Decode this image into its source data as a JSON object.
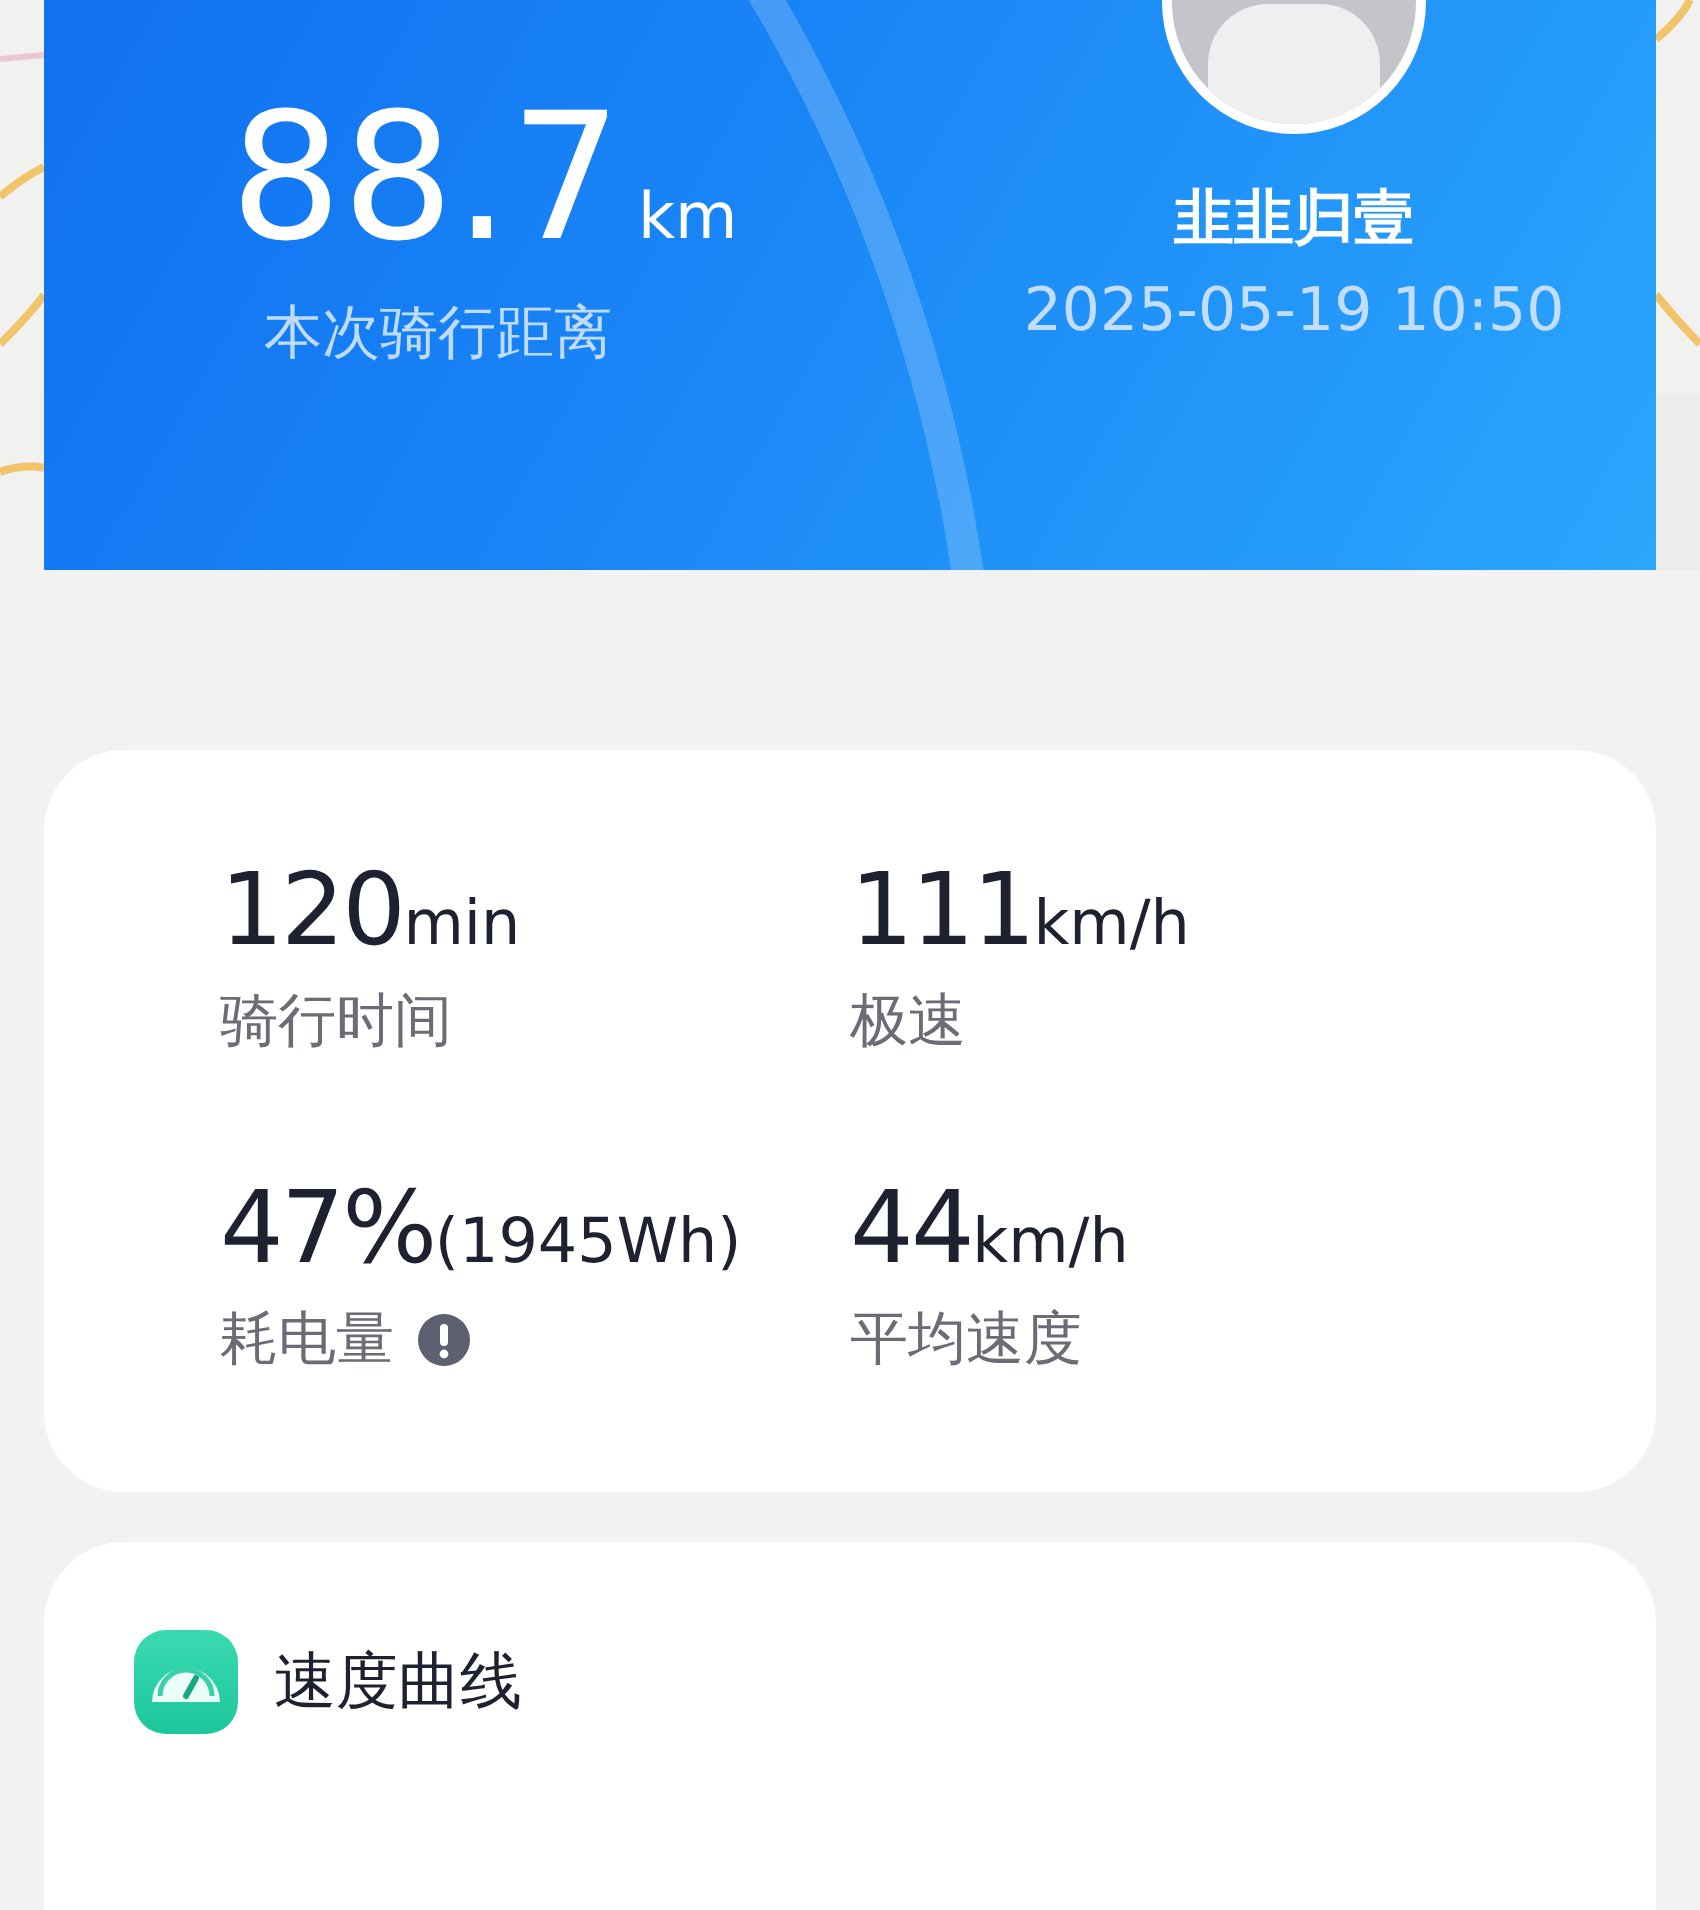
{
  "ride": {
    "distance": "88.7",
    "distance_unit": "km",
    "distance_label": "本次骑行距离",
    "rider_name": "韭韭归壹",
    "datetime": "2025-05-19 10:50"
  },
  "stats": [
    {
      "value": "120",
      "unit": "min",
      "label": "骑行时间",
      "info": false
    },
    {
      "value": "111",
      "unit": "km/h",
      "label": "极速",
      "info": false
    },
    {
      "value": "47%",
      "unit": "(1945Wh)",
      "label": "耗电量",
      "info": true
    },
    {
      "value": "44",
      "unit": "km/h",
      "label": "平均速度",
      "info": false
    }
  ],
  "speed_section": {
    "title": "速度曲线"
  }
}
